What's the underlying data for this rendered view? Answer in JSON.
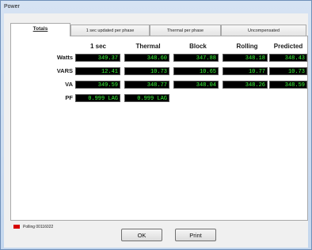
{
  "window": {
    "title": "Power"
  },
  "tabs": [
    {
      "label": "Totals",
      "active": true
    },
    {
      "label": "1 sec updated per phase"
    },
    {
      "label": "Thermal per phase"
    },
    {
      "label": "Uncompensated"
    }
  ],
  "table": {
    "columns": [
      "1 sec",
      "Thermal",
      "Block",
      "Rolling",
      "Predicted"
    ],
    "rows": [
      {
        "label": "Watts",
        "values": [
          "349.37",
          "348.60",
          "347.88",
          "348.18",
          "348.43"
        ]
      },
      {
        "label": "VARS",
        "values": [
          "12.41",
          "10.73",
          "10.65",
          "10.77",
          "10.73"
        ]
      },
      {
        "label": "VA",
        "values": [
          "349.59",
          "348.77",
          "348.04",
          "348.26",
          "348.59"
        ]
      },
      {
        "label": "PF",
        "values": [
          "0.999 LAG",
          "0.999 LAG"
        ]
      }
    ],
    "value_color": "#3cff3c",
    "cell_background": "#000000"
  },
  "status": {
    "indicator_color": "#d60000",
    "text": "Polling 00116022"
  },
  "buttons": {
    "ok": "OK",
    "print": "Print"
  }
}
